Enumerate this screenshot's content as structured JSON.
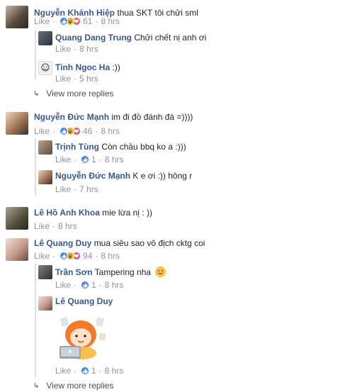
{
  "comments": [
    {
      "author": "Nguyễn Khánh Hiệp",
      "text": "thua SKT tôi chửi sml",
      "like": "Like",
      "reaction_count": "61",
      "time": "8 hrs",
      "replies": [
        {
          "author": "Quang Dang Trung",
          "text": "Chửi chết nị anh ơi",
          "like": "Like",
          "time": "8 hrs"
        },
        {
          "author": "Tinh Ngoc Ha",
          "text": ":))",
          "like": "Like",
          "time": "5 hrs"
        }
      ],
      "view_more": "View more replies"
    },
    {
      "author": "Nguyễn Đức Mạnh",
      "text": "im đi đồ đánh đá =))))",
      "like": "Like",
      "reaction_count": "46",
      "time": "8 hrs",
      "replies": [
        {
          "author": "Trịnh Tùng",
          "text": "Còn chầu bbq ko a :)))",
          "like": "Like",
          "reaction_count": "1",
          "time": "8 hrs"
        },
        {
          "author": "Nguyễn Đức Mạnh",
          "text": "K e ơi :)) hông r",
          "like": "Like",
          "time": "7 hrs"
        }
      ]
    },
    {
      "author": "Lê Hồ Anh Khoa",
      "text": "mie lừa nị : ))",
      "like": "Like",
      "time": "8 hrs"
    },
    {
      "author": "Lê Quang Duy",
      "text": "mua siêu sao vô địch cktg coi",
      "like": "Like",
      "reaction_count": "94",
      "time": "8 hrs",
      "replies": [
        {
          "author": "Trần Sơn",
          "text": "Tampering nha",
          "like": "Like",
          "reaction_count": "1",
          "time": "8 hrs"
        },
        {
          "author": "Lê Quang Duy",
          "text": "",
          "like": "Like",
          "reaction_count": "1",
          "time": "8 hrs"
        }
      ],
      "view_more": "View more replies"
    }
  ],
  "separator": "·",
  "colors": {
    "link": "#365899",
    "meta": "#90949c",
    "like_blue": "#4080ff",
    "haha_yellow": "#f7b125",
    "love_red": "#f25268",
    "border": "#dddfe2"
  }
}
